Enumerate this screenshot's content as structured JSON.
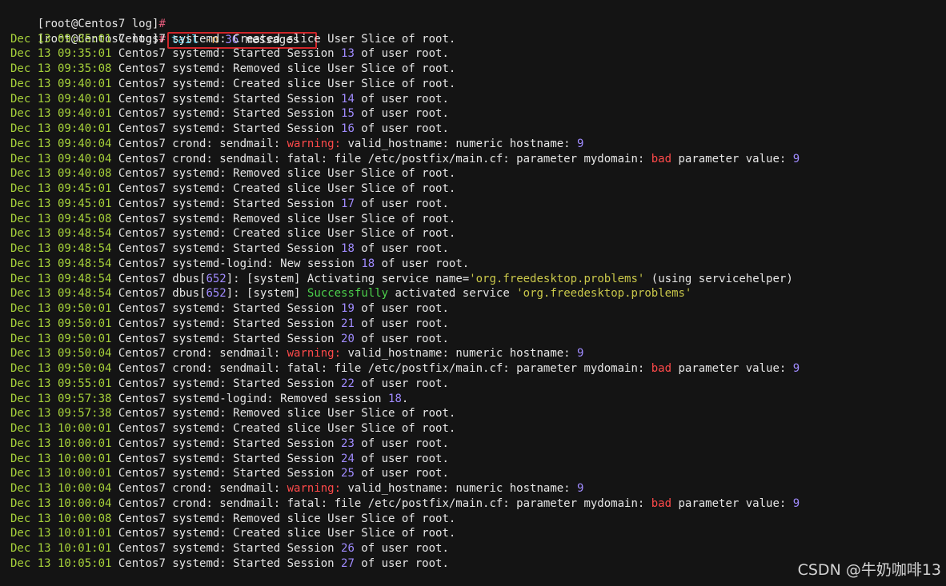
{
  "terminal": {
    "prompt": "[root@Centos7 log]",
    "prompt_symbol": "#",
    "command": {
      "name": "tail",
      "flag": "-n",
      "count": "36",
      "file": "messages"
    },
    "lines": [
      [
        {
          "t": "Dec 13 09:35:01",
          "c": "ts"
        },
        {
          "t": " Centos7 systemd: Created slice User Slice of root.",
          "c": ""
        }
      ],
      [
        {
          "t": "Dec 13 09:35:01",
          "c": "ts"
        },
        {
          "t": " Centos7 systemd: Started Session ",
          "c": ""
        },
        {
          "t": "13",
          "c": "num"
        },
        {
          "t": " of user root.",
          "c": ""
        }
      ],
      [
        {
          "t": "Dec 13 09:35:08",
          "c": "ts"
        },
        {
          "t": " Centos7 systemd: Removed slice User Slice of root.",
          "c": ""
        }
      ],
      [
        {
          "t": "Dec 13 09:40:01",
          "c": "ts"
        },
        {
          "t": " Centos7 systemd: Created slice User Slice of root.",
          "c": ""
        }
      ],
      [
        {
          "t": "Dec 13 09:40:01",
          "c": "ts"
        },
        {
          "t": " Centos7 systemd: Started Session ",
          "c": ""
        },
        {
          "t": "14",
          "c": "num"
        },
        {
          "t": " of user root.",
          "c": ""
        }
      ],
      [
        {
          "t": "Dec 13 09:40:01",
          "c": "ts"
        },
        {
          "t": " Centos7 systemd: Started Session ",
          "c": ""
        },
        {
          "t": "15",
          "c": "num"
        },
        {
          "t": " of user root.",
          "c": ""
        }
      ],
      [
        {
          "t": "Dec 13 09:40:01",
          "c": "ts"
        },
        {
          "t": " Centos7 systemd: Started Session ",
          "c": ""
        },
        {
          "t": "16",
          "c": "num"
        },
        {
          "t": " of user root.",
          "c": ""
        }
      ],
      [
        {
          "t": "Dec 13 09:40:04",
          "c": "ts"
        },
        {
          "t": " Centos7 crond: sendmail: ",
          "c": ""
        },
        {
          "t": "warning:",
          "c": "warn"
        },
        {
          "t": " valid_hostname: numeric hostname: ",
          "c": ""
        },
        {
          "t": "9",
          "c": "num"
        }
      ],
      [
        {
          "t": "Dec 13 09:40:04",
          "c": "ts"
        },
        {
          "t": " Centos7 crond: sendmail: fatal: file /etc/postfix/main.cf: parameter mydomain: ",
          "c": ""
        },
        {
          "t": "bad",
          "c": "bad"
        },
        {
          "t": " parameter value: ",
          "c": ""
        },
        {
          "t": "9",
          "c": "num"
        }
      ],
      [
        {
          "t": "Dec 13 09:40:08",
          "c": "ts"
        },
        {
          "t": " Centos7 systemd: Removed slice User Slice of root.",
          "c": ""
        }
      ],
      [
        {
          "t": "Dec 13 09:45:01",
          "c": "ts"
        },
        {
          "t": " Centos7 systemd: Created slice User Slice of root.",
          "c": ""
        }
      ],
      [
        {
          "t": "Dec 13 09:45:01",
          "c": "ts"
        },
        {
          "t": " Centos7 systemd: Started Session ",
          "c": ""
        },
        {
          "t": "17",
          "c": "num"
        },
        {
          "t": " of user root.",
          "c": ""
        }
      ],
      [
        {
          "t": "Dec 13 09:45:08",
          "c": "ts"
        },
        {
          "t": " Centos7 systemd: Removed slice User Slice of root.",
          "c": ""
        }
      ],
      [
        {
          "t": "Dec 13 09:48:54",
          "c": "ts"
        },
        {
          "t": " Centos7 systemd: Created slice User Slice of root.",
          "c": ""
        }
      ],
      [
        {
          "t": "Dec 13 09:48:54",
          "c": "ts"
        },
        {
          "t": " Centos7 systemd: Started Session ",
          "c": ""
        },
        {
          "t": "18",
          "c": "num"
        },
        {
          "t": " of user root.",
          "c": ""
        }
      ],
      [
        {
          "t": "Dec 13 09:48:54",
          "c": "ts"
        },
        {
          "t": " Centos7 systemd-logind: New session ",
          "c": ""
        },
        {
          "t": "18",
          "c": "num"
        },
        {
          "t": " of user root.",
          "c": ""
        }
      ],
      [
        {
          "t": "Dec 13 09:48:54",
          "c": "ts"
        },
        {
          "t": " Centos7 dbus[",
          "c": ""
        },
        {
          "t": "652",
          "c": "num"
        },
        {
          "t": "]: [system] Activating service name=",
          "c": ""
        },
        {
          "t": "'org.freedesktop.problems'",
          "c": "str"
        },
        {
          "t": " (using servicehelper)",
          "c": ""
        }
      ],
      [
        {
          "t": "Dec 13 09:48:54",
          "c": "ts"
        },
        {
          "t": " Centos7 dbus[",
          "c": ""
        },
        {
          "t": "652",
          "c": "num"
        },
        {
          "t": "]: [system] ",
          "c": ""
        },
        {
          "t": "Successfully",
          "c": "ok"
        },
        {
          "t": " activated service ",
          "c": ""
        },
        {
          "t": "'org.freedesktop.problems'",
          "c": "str"
        }
      ],
      [
        {
          "t": "Dec 13 09:50:01",
          "c": "ts"
        },
        {
          "t": " Centos7 systemd: Started Session ",
          "c": ""
        },
        {
          "t": "19",
          "c": "num"
        },
        {
          "t": " of user root.",
          "c": ""
        }
      ],
      [
        {
          "t": "Dec 13 09:50:01",
          "c": "ts"
        },
        {
          "t": " Centos7 systemd: Started Session ",
          "c": ""
        },
        {
          "t": "21",
          "c": "num"
        },
        {
          "t": " of user root.",
          "c": ""
        }
      ],
      [
        {
          "t": "Dec 13 09:50:01",
          "c": "ts"
        },
        {
          "t": " Centos7 systemd: Started Session ",
          "c": ""
        },
        {
          "t": "20",
          "c": "num"
        },
        {
          "t": " of user root.",
          "c": ""
        }
      ],
      [
        {
          "t": "Dec 13 09:50:04",
          "c": "ts"
        },
        {
          "t": " Centos7 crond: sendmail: ",
          "c": ""
        },
        {
          "t": "warning:",
          "c": "warn"
        },
        {
          "t": " valid_hostname: numeric hostname: ",
          "c": ""
        },
        {
          "t": "9",
          "c": "num"
        }
      ],
      [
        {
          "t": "Dec 13 09:50:04",
          "c": "ts"
        },
        {
          "t": " Centos7 crond: sendmail: fatal: file /etc/postfix/main.cf: parameter mydomain: ",
          "c": ""
        },
        {
          "t": "bad",
          "c": "bad"
        },
        {
          "t": " parameter value: ",
          "c": ""
        },
        {
          "t": "9",
          "c": "num"
        }
      ],
      [
        {
          "t": "Dec 13 09:55:01",
          "c": "ts"
        },
        {
          "t": " Centos7 systemd: Started Session ",
          "c": ""
        },
        {
          "t": "22",
          "c": "num"
        },
        {
          "t": " of user root.",
          "c": ""
        }
      ],
      [
        {
          "t": "Dec 13 09:57:38",
          "c": "ts"
        },
        {
          "t": " Centos7 systemd-logind: Removed session ",
          "c": ""
        },
        {
          "t": "18",
          "c": "num"
        },
        {
          "t": ".",
          "c": ""
        }
      ],
      [
        {
          "t": "Dec 13 09:57:38",
          "c": "ts"
        },
        {
          "t": " Centos7 systemd: Removed slice User Slice of root.",
          "c": ""
        }
      ],
      [
        {
          "t": "Dec 13 10:00:01",
          "c": "ts"
        },
        {
          "t": " Centos7 systemd: Created slice User Slice of root.",
          "c": ""
        }
      ],
      [
        {
          "t": "Dec 13 10:00:01",
          "c": "ts"
        },
        {
          "t": " Centos7 systemd: Started Session ",
          "c": ""
        },
        {
          "t": "23",
          "c": "num"
        },
        {
          "t": " of user root.",
          "c": ""
        }
      ],
      [
        {
          "t": "Dec 13 10:00:01",
          "c": "ts"
        },
        {
          "t": " Centos7 systemd: Started Session ",
          "c": ""
        },
        {
          "t": "24",
          "c": "num"
        },
        {
          "t": " of user root.",
          "c": ""
        }
      ],
      [
        {
          "t": "Dec 13 10:00:01",
          "c": "ts"
        },
        {
          "t": " Centos7 systemd: Started Session ",
          "c": ""
        },
        {
          "t": "25",
          "c": "num"
        },
        {
          "t": " of user root.",
          "c": ""
        }
      ],
      [
        {
          "t": "Dec 13 10:00:04",
          "c": "ts"
        },
        {
          "t": " Centos7 crond: sendmail: ",
          "c": ""
        },
        {
          "t": "warning:",
          "c": "warn"
        },
        {
          "t": " valid_hostname: numeric hostname: ",
          "c": ""
        },
        {
          "t": "9",
          "c": "num"
        }
      ],
      [
        {
          "t": "Dec 13 10:00:04",
          "c": "ts"
        },
        {
          "t": " Centos7 crond: sendmail: fatal: file /etc/postfix/main.cf: parameter mydomain: ",
          "c": ""
        },
        {
          "t": "bad",
          "c": "bad"
        },
        {
          "t": " parameter value: ",
          "c": ""
        },
        {
          "t": "9",
          "c": "num"
        }
      ],
      [
        {
          "t": "Dec 13 10:00:08",
          "c": "ts"
        },
        {
          "t": " Centos7 systemd: Removed slice User Slice of root.",
          "c": ""
        }
      ],
      [
        {
          "t": "Dec 13 10:01:01",
          "c": "ts"
        },
        {
          "t": " Centos7 systemd: Created slice User Slice of root.",
          "c": ""
        }
      ],
      [
        {
          "t": "Dec 13 10:01:01",
          "c": "ts"
        },
        {
          "t": " Centos7 systemd: Started Session ",
          "c": ""
        },
        {
          "t": "26",
          "c": "num"
        },
        {
          "t": " of user root.",
          "c": ""
        }
      ],
      [
        {
          "t": "Dec 13 10:05:01",
          "c": "ts"
        },
        {
          "t": " Centos7 systemd: Started Session ",
          "c": ""
        },
        {
          "t": "27",
          "c": "num"
        },
        {
          "t": " of user root.",
          "c": ""
        }
      ]
    ]
  },
  "watermark": "CSDN @牛奶咖啡13",
  "colors": {
    "background": "#141414",
    "timestamp": "#a6d13a",
    "number": "#a08bff",
    "prompt_hash": "#e05a7a",
    "warning": "#ff4a4a",
    "success": "#4cd14c",
    "string": "#c9c74a",
    "command": "#4ac6e6",
    "highlight_box": "#d0262a"
  }
}
